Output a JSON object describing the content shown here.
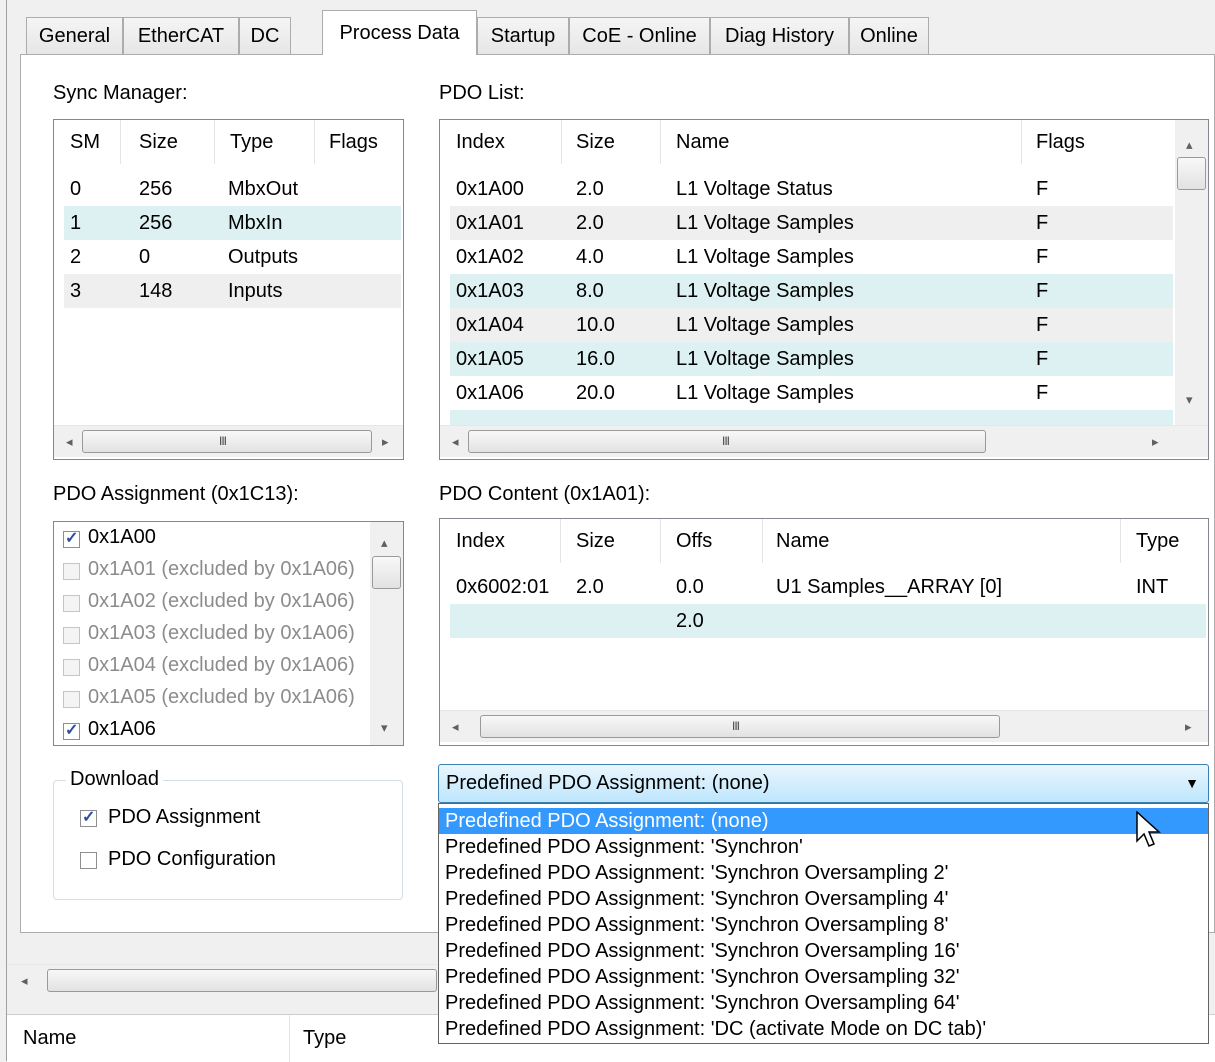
{
  "tabs": [
    "General",
    "EtherCAT",
    "DC",
    "Process Data",
    "Startup",
    "CoE - Online",
    "Diag History",
    "Online"
  ],
  "sync_manager": {
    "label": "Sync Manager:",
    "columns": [
      "SM",
      "Size",
      "Type",
      "Flags"
    ],
    "rows": [
      [
        "0",
        "256",
        "MbxOut",
        ""
      ],
      [
        "1",
        "256",
        "MbxIn",
        ""
      ],
      [
        "2",
        "0",
        "Outputs",
        ""
      ],
      [
        "3",
        "148",
        "Inputs",
        ""
      ]
    ]
  },
  "pdo_list": {
    "label": "PDO List:",
    "columns": [
      "Index",
      "Size",
      "Name",
      "Flags"
    ],
    "rows": [
      [
        "0x1A00",
        "2.0",
        "L1 Voltage Status",
        "F"
      ],
      [
        "0x1A01",
        "2.0",
        "L1 Voltage Samples",
        "F"
      ],
      [
        "0x1A02",
        "4.0",
        "L1 Voltage Samples",
        "F"
      ],
      [
        "0x1A03",
        "8.0",
        "L1 Voltage Samples",
        "F"
      ],
      [
        "0x1A04",
        "10.0",
        "L1 Voltage Samples",
        "F"
      ],
      [
        "0x1A05",
        "16.0",
        "L1 Voltage Samples",
        "F"
      ],
      [
        "0x1A06",
        "20.0",
        "L1 Voltage Samples",
        "F"
      ]
    ]
  },
  "pdo_assignment": {
    "label": "PDO Assignment (0x1C13):",
    "items": [
      {
        "label": "0x1A00",
        "checked": true,
        "enabled": true
      },
      {
        "label": "0x1A01 (excluded by 0x1A06)",
        "checked": false,
        "enabled": false
      },
      {
        "label": "0x1A02 (excluded by 0x1A06)",
        "checked": false,
        "enabled": false
      },
      {
        "label": "0x1A03 (excluded by 0x1A06)",
        "checked": false,
        "enabled": false
      },
      {
        "label": "0x1A04 (excluded by 0x1A06)",
        "checked": false,
        "enabled": false
      },
      {
        "label": "0x1A05 (excluded by 0x1A06)",
        "checked": false,
        "enabled": false
      },
      {
        "label": "0x1A06",
        "checked": true,
        "enabled": true
      }
    ]
  },
  "pdo_content": {
    "label": "PDO Content (0x1A01):",
    "columns": [
      "Index",
      "Size",
      "Offs",
      "Name",
      "Type"
    ],
    "rows": [
      [
        "0x6002:01",
        "2.0",
        "0.0",
        "U1 Samples__ARRAY [0]",
        "INT"
      ],
      [
        "",
        "",
        "2.0",
        "",
        ""
      ]
    ]
  },
  "download": {
    "label": "Download",
    "pdo_assignment": "PDO Assignment",
    "pdo_configuration": "PDO Configuration"
  },
  "predefined": {
    "selected": "Predefined PDO Assignment: (none)",
    "options": [
      "Predefined PDO Assignment: (none)",
      "Predefined PDO Assignment: 'Synchron'",
      "Predefined PDO Assignment: 'Synchron Oversampling 2'",
      "Predefined PDO Assignment: 'Synchron Oversampling 4'",
      "Predefined PDO Assignment: 'Synchron Oversampling 8'",
      "Predefined PDO Assignment: 'Synchron Oversampling 16'",
      "Predefined PDO Assignment: 'Synchron Oversampling 32'",
      "Predefined PDO Assignment: 'Synchron Oversampling 64'",
      "Predefined PDO Assignment: 'DC (activate Mode on DC tab)'"
    ]
  },
  "bottom_grid": {
    "columns": [
      "Name",
      "Type"
    ]
  },
  "icons": {
    "scroll_left": "◂",
    "scroll_right": "▸",
    "scroll_up": "▴",
    "scroll_down": "▾",
    "combo_arrow": "▼",
    "grip": "III",
    "cursor": "arrow-cursor-icon"
  }
}
